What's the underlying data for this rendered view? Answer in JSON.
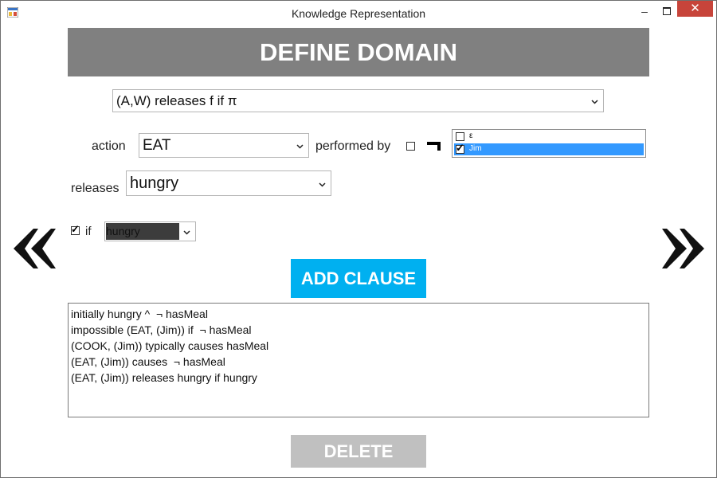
{
  "window": {
    "title": "Knowledge Representation",
    "minimize_glyph": "–",
    "close_glyph": "✕"
  },
  "header": {
    "title": "DEFINE DOMAIN"
  },
  "clause_type": {
    "selected": "(A,W) releases f if π"
  },
  "action": {
    "label": "action",
    "selected": "EAT"
  },
  "performed_by": {
    "label": "performed by",
    "negate_checked": false,
    "negation_symbol": "¬",
    "agents": [
      {
        "name": "ε",
        "checked": false,
        "selected": false
      },
      {
        "name": "Jim",
        "checked": true,
        "selected": true
      }
    ]
  },
  "releases": {
    "label": "releases",
    "selected": "hungry"
  },
  "condition": {
    "if_checked": true,
    "label": "if",
    "selected": "hungry"
  },
  "buttons": {
    "add_clause": "ADD CLAUSE",
    "delete": "DELETE"
  },
  "clauses": [
    "initially hungry ^  ¬ hasMeal",
    "impossible (EAT, (Jim)) if  ¬ hasMeal",
    "(COOK, (Jim)) typically causes hasMeal",
    "(EAT, (Jim)) causes  ¬ hasMeal",
    "(EAT, (Jim)) releases hungry if hungry"
  ],
  "icons": {
    "app": "app-icon",
    "prev": "double-chevron-left-icon",
    "next": "double-chevron-right-icon",
    "dropdown": "chevron-down-icon"
  },
  "colors": {
    "banner": "#808080",
    "add_button": "#00b0f0",
    "delete_button": "#c0c0c0",
    "selection": "#3399ff",
    "close_button": "#c7443a"
  }
}
